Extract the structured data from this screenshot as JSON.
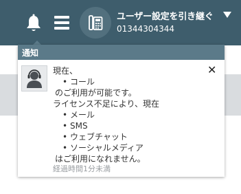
{
  "header": {
    "user_name": "ユーザー設定を引き継ぐ",
    "user_number": "01344304344",
    "icons": {
      "bell": "bell-icon",
      "menu": "hamburger-menu-icon",
      "phone": "desk-phone-icon",
      "dropdown": "caret-down-icon"
    },
    "colors": {
      "header_bg": "#3e5d6c",
      "popup_header_bg": "#5b7a89"
    }
  },
  "notifications": {
    "title": "通知",
    "item": {
      "line_1": "現在、",
      "available_channel": "コール",
      "line_2": "のご利用が可能です。",
      "line_3": "ライセンス不足により、現在",
      "unavailable_channels": [
        "メール",
        "SMS",
        "ウェブチャット",
        "ソーシャルメディア"
      ],
      "line_4": "はご利用になれません。",
      "elapsed": "経過時間1分未満",
      "close_label": "✕"
    }
  }
}
